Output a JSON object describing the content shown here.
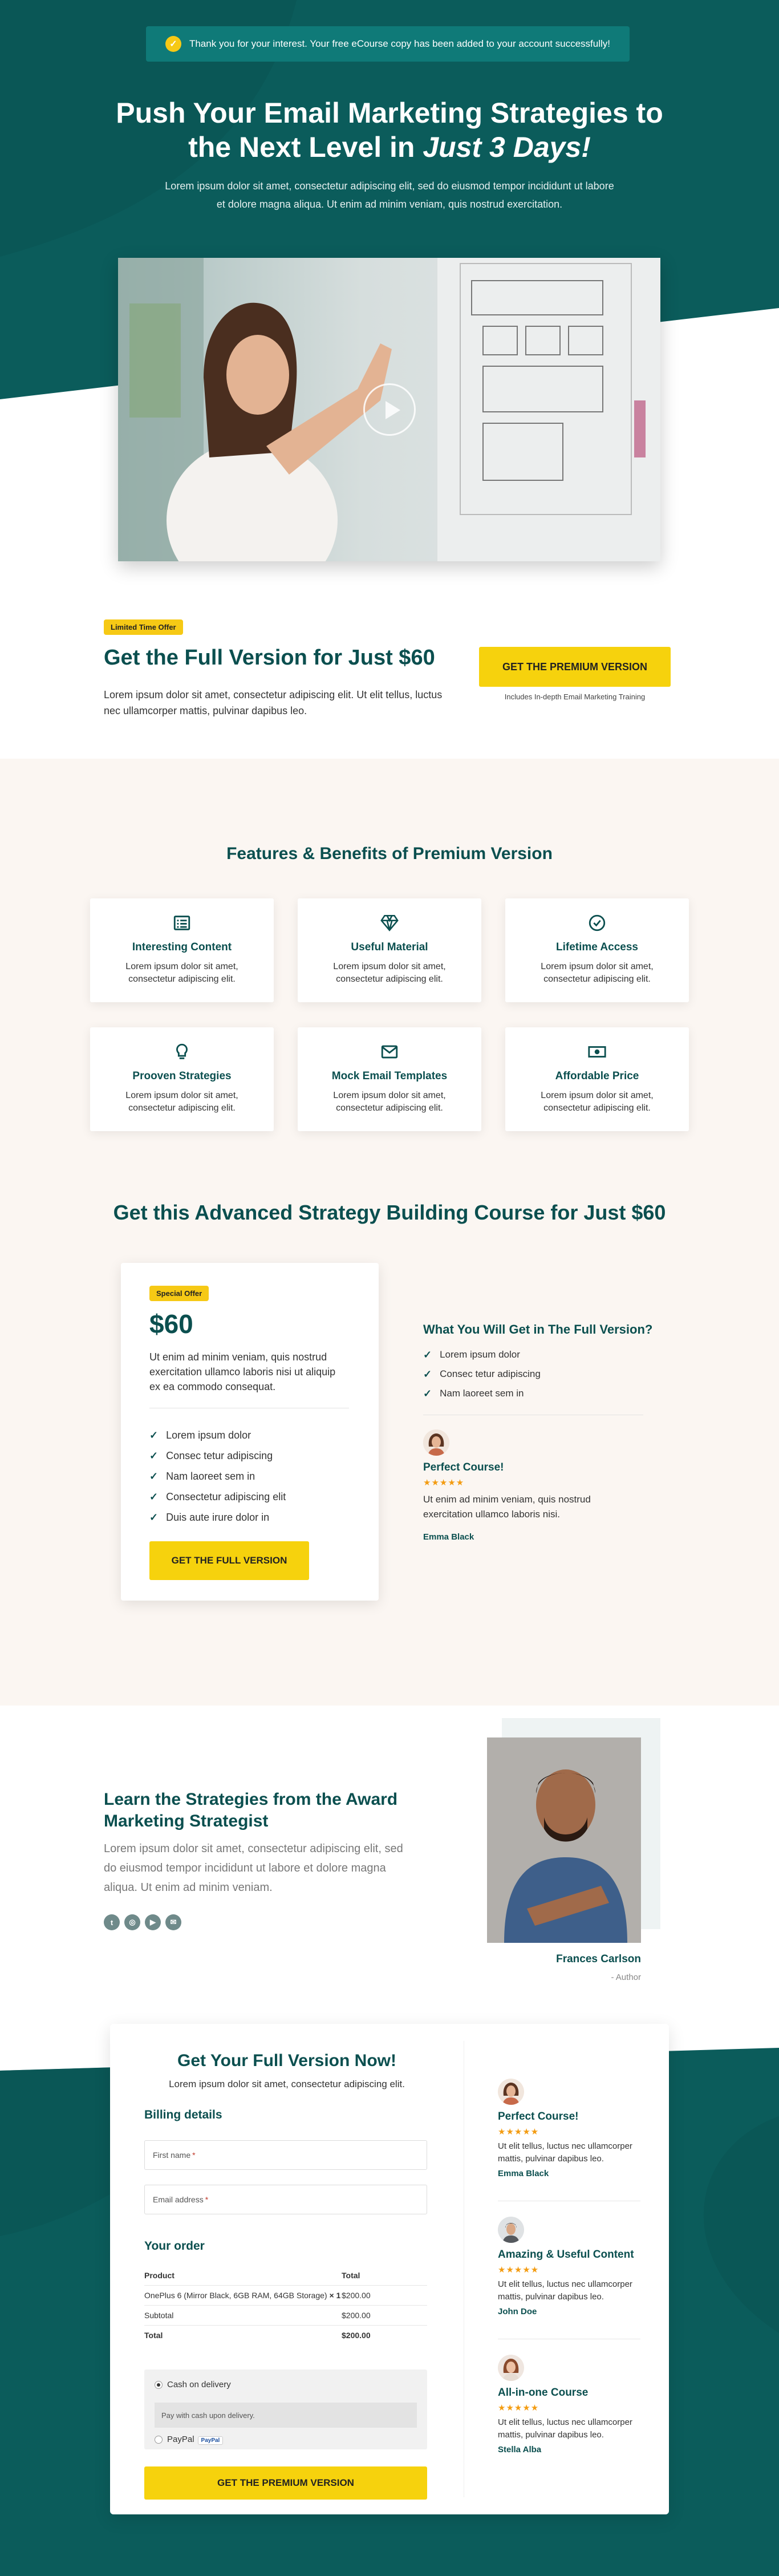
{
  "colors": {
    "primary": "#0b4f4f",
    "accent": "#f6d20d",
    "background": "#fbf6f2"
  },
  "notice": {
    "icon": "check-circle-icon",
    "text": "Thank you for your interest. Your free eCourse copy has been added to your account successfully!"
  },
  "hero": {
    "title_line1": "Push Your Email Marketing Strategies to",
    "title_line2_prefix": "the Next Level in ",
    "title_line2_em": "Just 3 Days!",
    "description": "Lorem ipsum dolor sit amet, consectetur adipiscing elit, sed do eiusmod tempor incididunt ut labore et dolore magna aliqua. Ut enim ad minim veniam, quis nostrud exercitation."
  },
  "video": {
    "play_icon": "play-icon"
  },
  "offer": {
    "badge": "Limited Time Offer",
    "title": "Get the Full Version for Just $60",
    "description": "Lorem ipsum dolor sit amet, consectetur adipiscing elit. Ut elit tellus, luctus nec ullamcorper mattis, pulvinar dapibus leo.",
    "button": "Get the Premium Version",
    "note": "Includes In-depth Email Marketing Training"
  },
  "features": {
    "title": "Features & Benefits of Premium Version",
    "items": [
      {
        "icon": "list-icon",
        "title": "Interesting Content",
        "desc": "Lorem ipsum dolor sit amet, consectetur adipiscing elit."
      },
      {
        "icon": "diamond-icon",
        "title": "Useful Material",
        "desc": "Lorem ipsum dolor sit amet, consectetur adipiscing elit."
      },
      {
        "icon": "check-circle-icon",
        "title": "Lifetime Access",
        "desc": "Lorem ipsum dolor sit amet, consectetur adipiscing elit."
      },
      {
        "icon": "lightbulb-icon",
        "title": "Prooven Strategies",
        "desc": "Lorem ipsum dolor sit amet, consectetur adipiscing elit."
      },
      {
        "icon": "envelope-icon",
        "title": "Mock Email Templates",
        "desc": "Lorem ipsum dolor sit amet, consectetur adipiscing elit."
      },
      {
        "icon": "money-bill-icon",
        "title": "Affordable Price",
        "desc": "Lorem ipsum dolor sit amet, consectetur adipiscing elit."
      }
    ]
  },
  "course": {
    "title": "Get this Advanced Strategy Building Course for Just $60",
    "card": {
      "badge": "Special Offer",
      "price": "$60",
      "description": "Ut enim ad minim veniam, quis nostrud exercitation ullamco laboris nisi ut aliquip ex ea commodo consequat.",
      "items": [
        "Lorem ipsum dolor",
        "Consec tetur adipiscing",
        "Nam laoreet sem in",
        "Consectetur adipiscing elit",
        "Duis aute irure dolor in"
      ],
      "button": "Get the Full Version"
    },
    "what_you_get": {
      "title": "What You Will Get in The Full Version?",
      "items": [
        "Lorem ipsum dolor",
        "Consec tetur adipiscing",
        "Nam laoreet sem in"
      ]
    },
    "testimonial": {
      "title": "Perfect Course!",
      "stars": "★★★★★",
      "text": "Ut enim ad minim veniam, quis nostrud exercitation ullamco laboris nisi.",
      "author": "Emma Black"
    }
  },
  "author": {
    "title": "Learn the Strategies from the Award Marketing Strategist",
    "description": "Lorem ipsum dolor sit amet, consectetur adipiscing elit, sed do eiusmod tempor incididunt ut labore et dolore magna aliqua. Ut enim ad minim veniam.",
    "name": "Frances Carlson",
    "role": "- Author",
    "socials": [
      "twitter-icon",
      "dribbble-icon",
      "youtube-icon",
      "email-icon"
    ]
  },
  "checkout": {
    "title": "Get Your Full Version Now!",
    "subtitle": "Lorem ipsum dolor sit amet, consectetur adipiscing elit.",
    "billing_title": "Billing details",
    "first_name": "First name",
    "email": "Email address",
    "order_title": "Your order",
    "table": {
      "head_product": "Product",
      "head_total": "Total",
      "item_name": "OnePlus 6 (Mirror Black, 6GB RAM, 64GB Storage)",
      "item_qty": "× 1",
      "item_total": "$200.00",
      "subtotal_label": "Subtotal",
      "subtotal": "$200.00",
      "total_label": "Total",
      "total": "$200.00"
    },
    "payment": {
      "cod": "Cash on delivery",
      "cod_note": "Pay with cash upon delivery.",
      "paypal": "PayPal",
      "paypal_badge": "PayPal"
    },
    "button": "Get the Premium Version"
  },
  "testimonials": [
    {
      "title": "Perfect Course!",
      "stars": "★★★★★",
      "text": "Ut elit tellus, luctus nec ullamcorper mattis, pulvinar dapibus leo.",
      "author": "Emma Black"
    },
    {
      "title": "Amazing & Useful Content",
      "stars": "★★★★★",
      "text": "Ut elit tellus, luctus nec ullamcorper mattis, pulvinar dapibus leo.",
      "author": "John Doe"
    },
    {
      "title": "All-in-one Course",
      "stars": "★★★★★",
      "text": "Ut elit tellus, luctus nec ullamcorper mattis, pulvinar dapibus leo.",
      "author": "Stella Alba"
    }
  ]
}
